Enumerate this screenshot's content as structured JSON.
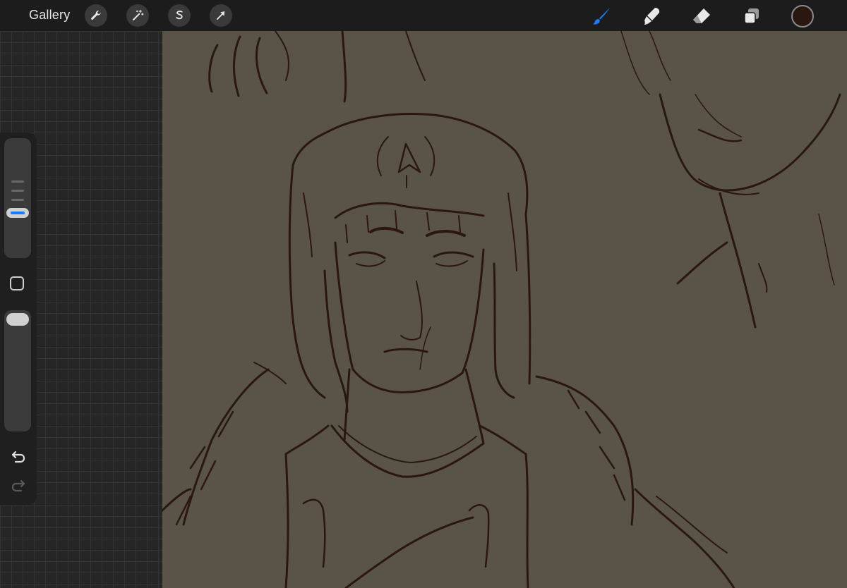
{
  "toolbar": {
    "gallery_label": "Gallery",
    "left_tools": [
      "wrench-icon",
      "magic-wand-icon",
      "selection-s-icon",
      "transform-arrow-icon"
    ],
    "right_tools": [
      "brush-icon",
      "smudge-icon",
      "eraser-icon",
      "layers-icon"
    ],
    "active_tool": "brush",
    "active_color": "#2a1810",
    "accent_color": "#1a7cff"
  },
  "sidebar": {
    "controls": [
      "brush-size-slider",
      "modify-button",
      "opacity-slider",
      "undo-icon",
      "redo-icon"
    ]
  },
  "canvas": {
    "background_color": "#5a5348",
    "ink_color": "#2a1810",
    "content": "sketch-artwork"
  }
}
